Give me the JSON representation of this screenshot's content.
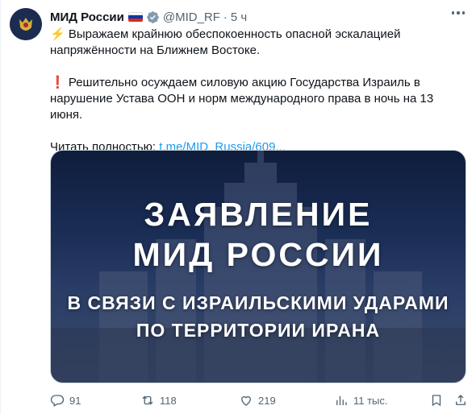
{
  "account": {
    "name": "МИД России",
    "handle": "@MID_RF",
    "time": "5 ч",
    "separator": "·"
  },
  "tweet": {
    "line1": "⚡ Выражаем крайнюю обеспокоенность опасной эскалацией напряжённости на Ближнем Востоке.",
    "line2": "❗ Решительно осуждаем силовую акцию Государства Израиль в нарушение Устава ООН и норм международного права в ночь на 13 июня.",
    "read_more_label": "Читать полностью:",
    "read_more_link": "t.me/MID_Russia/609..."
  },
  "media": {
    "title_line1": "ЗАЯВЛЕНИЕ",
    "title_line2": "МИД РОССИИ",
    "subtitle_line1": "В СВЯЗИ С ИЗРАИЛЬСКИМИ УДАРАМИ",
    "subtitle_line2": "ПО ТЕРРИТОРИИ ИРАНА"
  },
  "actions": {
    "replies": "91",
    "reposts": "118",
    "likes": "219",
    "views": "11 тыс."
  },
  "colors": {
    "link": "#1d9bf0",
    "muted": "#536471",
    "verified": "#1d9bf0"
  }
}
